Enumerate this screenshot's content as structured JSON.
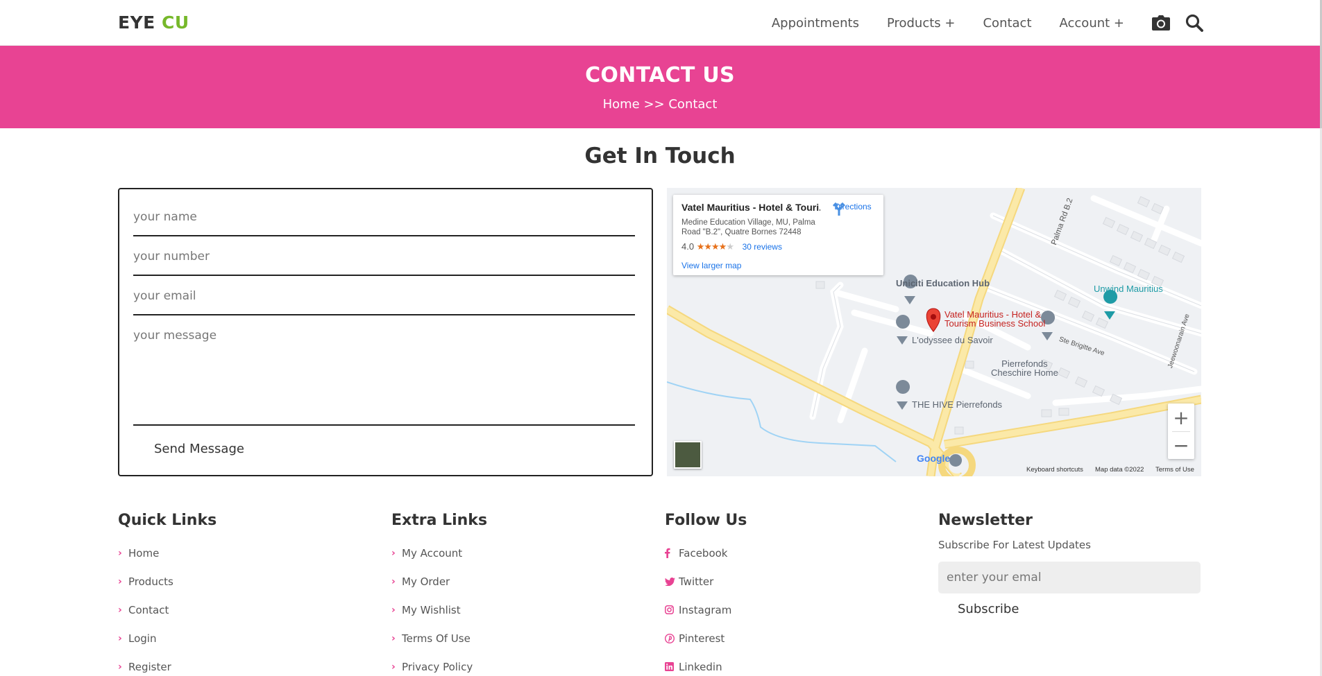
{
  "header": {
    "logo_main": "EYE",
    "logo_accent": "CU",
    "nav": [
      "Appointments",
      "Products +",
      "Contact",
      "Account +"
    ]
  },
  "banner": {
    "title": "CONTACT US",
    "breadcrumb": "Home >> Contact"
  },
  "section_title": "Get In Touch",
  "form": {
    "name_placeholder": "your name",
    "number_placeholder": "your number",
    "email_placeholder": "your email",
    "message_placeholder": "your message",
    "submit_label": "Send Message"
  },
  "map": {
    "card_title": "Vatel Mauritius - Hotel & Touri...",
    "card_address": "Medine Education Village, MU, Palma Road \"B.2\", Quatre Bornes 72448",
    "rating": "4.0",
    "stars": "★★★★",
    "star_empty": "★",
    "reviews": "30 reviews",
    "view_larger": "View larger map",
    "directions": "Directions",
    "places": {
      "uniciti": "Uniciti Education Hub",
      "vatel_line1": "Vatel Mauritius - Hotel &",
      "vatel_line2": "Tourism Business School",
      "odyssee": "L'odyssee du Savoir",
      "unwind": "Unwind Mauritius",
      "pierrefonds_line1": "Pierrefonds",
      "pierrefonds_line2": "Cheschire Home",
      "hive": "THE HIVE Pierrefonds",
      "palma": "Palma Rd B.2",
      "brigitte": "Ste Brigitte Ave",
      "jeewoonarain": "Jeewoonarain Ave"
    },
    "google": "Google",
    "footer_shortcuts": "Keyboard shortcuts",
    "footer_data": "Map data ©2022",
    "footer_terms": "Terms of Use"
  },
  "footer": {
    "quick_links": {
      "title": "Quick Links",
      "items": [
        "Home",
        "Products",
        "Contact",
        "Login",
        "Register"
      ]
    },
    "extra_links": {
      "title": "Extra Links",
      "items": [
        "My Account",
        "My Order",
        "My Wishlist",
        "Terms Of Use",
        "Privacy Policy"
      ]
    },
    "follow_us": {
      "title": "Follow Us",
      "items": [
        {
          "label": "Facebook",
          "icon": "facebook-icon"
        },
        {
          "label": "Twitter",
          "icon": "twitter-icon"
        },
        {
          "label": "Instagram",
          "icon": "instagram-icon"
        },
        {
          "label": "Pinterest",
          "icon": "pinterest-icon"
        },
        {
          "label": "Linkedin",
          "icon": "linkedin-icon"
        }
      ]
    },
    "newsletter": {
      "title": "Newsletter",
      "subtitle": "Subscribe For Latest Updates",
      "placeholder": "enter your emal",
      "button": "Subscribe"
    }
  },
  "colors": {
    "brand_pink": "#e84393",
    "brand_green": "#76b82a"
  }
}
